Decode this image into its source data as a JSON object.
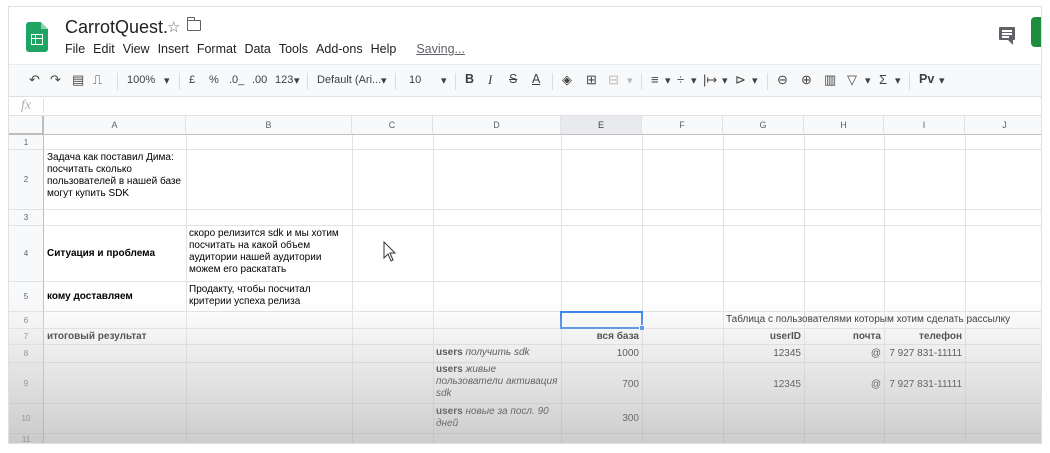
{
  "app": {
    "title": "CarrotQuest.",
    "icon": "google-sheets-icon",
    "menu": [
      "File",
      "Edit",
      "View",
      "Insert",
      "Format",
      "Data",
      "Tools",
      "Add-ons",
      "Help"
    ],
    "saving_status": "Saving..."
  },
  "toolbar": {
    "zoom": "100%",
    "currency": "£",
    "percent": "%",
    "decrease_decimals": ".0_",
    "increase_decimals": ".00",
    "number_format": "123",
    "font": "Default (Ari...",
    "font_size": "10",
    "bold": "B",
    "italic": "I",
    "strikethrough": "S",
    "text_color": "A",
    "addon": "Pv"
  },
  "formula_bar": {
    "fx_label": "fx",
    "value": ""
  },
  "sheet": {
    "columns": [
      "A",
      "B",
      "C",
      "D",
      "E",
      "F",
      "G",
      "H",
      "I",
      "J"
    ],
    "rows": [
      "1",
      "2",
      "3",
      "4",
      "5",
      "6",
      "7",
      "8",
      "9",
      "10",
      "11"
    ],
    "cells": {
      "A2": "Задача как поставил Дима: посчитать сколько пользователей в нашей базе могут купить SDK",
      "A4": "Ситуация и проблема",
      "B4": "скоро релизится sdk и мы хотим посчитать на какой объем аудитории нашей аудитории можем его раскатать",
      "A5": "кому доставляем",
      "B5": "Продакту, чтобы посчитал критерии успеха релиза",
      "G6": "Таблица с пользователями которым хотим сделать рассылку",
      "A7": "итоговый результат",
      "E7": "вся база",
      "G7": "userID",
      "H7": "почта",
      "I7": "телефон",
      "D8_bold": "users",
      "D8_italic": "получить sdk",
      "E8": "1000",
      "G8": "12345",
      "H8": "@",
      "I8": "7 927 831-11111",
      "D9_bold": "users",
      "D9_italic": "живые пользователи активация sdk",
      "E9": "700",
      "G9": "12345",
      "H9": "@",
      "I9": "7 927 831-11111",
      "D10_bold": "users",
      "D10_italic": "новые за посл. 90 дней",
      "E10": "300"
    },
    "selected_cell": "E6"
  },
  "colors": {
    "accent": "#1a73e8",
    "sheets_green": "#1fa463"
  }
}
